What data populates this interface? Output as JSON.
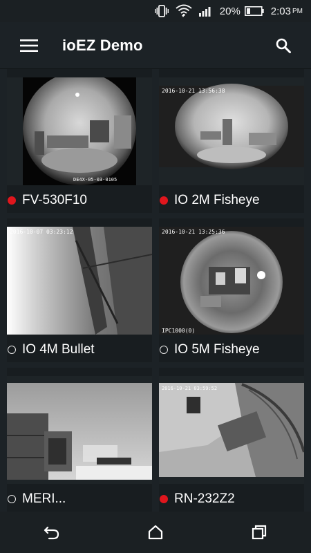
{
  "status_bar": {
    "battery_percent": "20%",
    "time": "2:03",
    "ampm": "PM",
    "icons": [
      "vibrate-icon",
      "wifi-icon",
      "signal-icon",
      "battery-icon"
    ]
  },
  "app_bar": {
    "title": "ioEZ Demo",
    "menu_icon": "hamburger-menu-icon",
    "search_icon": "search-icon"
  },
  "cameras": [
    {
      "name": "FV-530F10",
      "status": "recording",
      "overlay_text": "DE4X-05-03-0105"
    },
    {
      "name": "IO 2M Fisheye",
      "status": "recording",
      "overlay_text": "2016-10-21 13:56:38"
    },
    {
      "name": "IO 4M Bullet",
      "status": "idle",
      "overlay_text": "2016-10-07 03:23:12"
    },
    {
      "name": "IO 5M Fisheye",
      "status": "idle",
      "overlay_text": "2016-10-21 13:25:36",
      "overlay_text_2": "IPC1000(0)"
    },
    {
      "name": "MERI...",
      "status": "idle",
      "overlay_text": ""
    },
    {
      "name": "RN-232Z2",
      "status": "recording",
      "overlay_text": "2016-10-21 03:59:52"
    }
  ],
  "colors": {
    "background": "#1c2226",
    "recording_dot": "#e0161d",
    "text": "#ffffff"
  },
  "nav_bar": {
    "buttons": [
      "back-icon",
      "home-icon",
      "recent-apps-icon"
    ]
  }
}
